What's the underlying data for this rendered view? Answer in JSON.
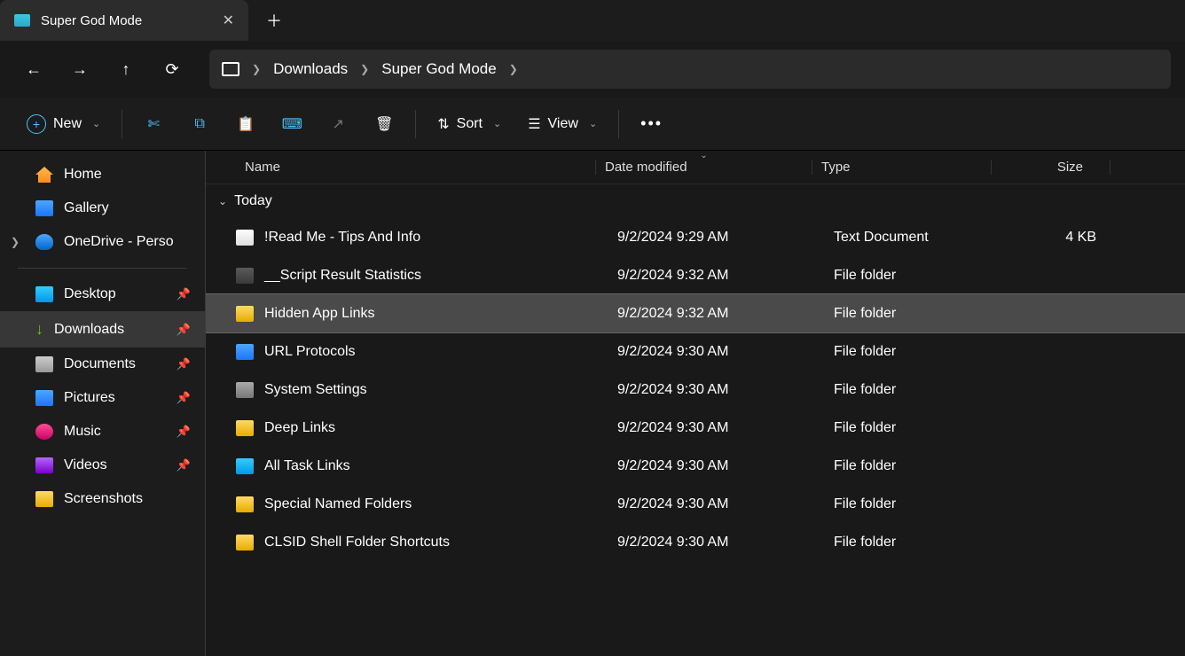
{
  "tab": {
    "title": "Super God Mode"
  },
  "breadcrumb": {
    "items": [
      "Downloads",
      "Super God Mode"
    ]
  },
  "toolbar": {
    "new": "New",
    "sort": "Sort",
    "view": "View"
  },
  "sidebar": {
    "top": [
      {
        "label": "Home"
      },
      {
        "label": "Gallery"
      },
      {
        "label": "OneDrive - Perso",
        "expandable": true
      }
    ],
    "quick": [
      {
        "label": "Desktop"
      },
      {
        "label": "Downloads"
      },
      {
        "label": "Documents"
      },
      {
        "label": "Pictures"
      },
      {
        "label": "Music"
      },
      {
        "label": "Videos"
      },
      {
        "label": "Screenshots"
      }
    ]
  },
  "columns": {
    "name": "Name",
    "date": "Date modified",
    "type": "Type",
    "size": "Size"
  },
  "group": "Today",
  "files": [
    {
      "name": "!Read Me - Tips And Info",
      "date": "9/2/2024 9:29 AM",
      "type": "Text Document",
      "size": "4 KB",
      "icon": "fi-txt"
    },
    {
      "name": "__Script Result Statistics",
      "date": "9/2/2024 9:32 AM",
      "type": "File folder",
      "size": "",
      "icon": "fi-folder"
    },
    {
      "name": "Hidden App Links",
      "date": "9/2/2024 9:32 AM",
      "type": "File folder",
      "size": "",
      "icon": "fi-folder-y",
      "selected": true
    },
    {
      "name": "URL Protocols",
      "date": "9/2/2024 9:30 AM",
      "type": "File folder",
      "size": "",
      "icon": "fi-url"
    },
    {
      "name": "System Settings",
      "date": "9/2/2024 9:30 AM",
      "type": "File folder",
      "size": "",
      "icon": "fi-gear"
    },
    {
      "name": "Deep Links",
      "date": "9/2/2024 9:30 AM",
      "type": "File folder",
      "size": "",
      "icon": "fi-folder-y"
    },
    {
      "name": "All Task Links",
      "date": "9/2/2024 9:30 AM",
      "type": "File folder",
      "size": "",
      "icon": "fi-blue"
    },
    {
      "name": "Special Named Folders",
      "date": "9/2/2024 9:30 AM",
      "type": "File folder",
      "size": "",
      "icon": "fi-folder-y"
    },
    {
      "name": "CLSID Shell Folder Shortcuts",
      "date": "9/2/2024 9:30 AM",
      "type": "File folder",
      "size": "",
      "icon": "fi-folder-y"
    }
  ]
}
